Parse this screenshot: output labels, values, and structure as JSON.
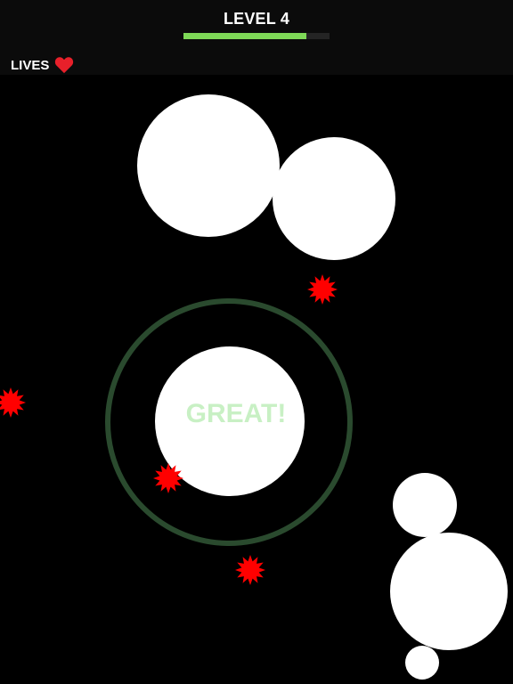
{
  "hud": {
    "level_label": "LEVEL 4",
    "level_progress": 0.84,
    "lives_label": "LIVES",
    "lives_count": 1,
    "heart_icon": "heart-icon"
  },
  "feedback": {
    "text": "GREAT!"
  },
  "colors": {
    "background": "#000000",
    "hud_text": "#ffffff",
    "progress_fill": "#7ed957",
    "heart": "#e8202a",
    "ball": "#ffffff",
    "target_ring": "#2a4a2e",
    "spike_mine": "#ff0000",
    "feedback_text": "#c8f0c4"
  }
}
